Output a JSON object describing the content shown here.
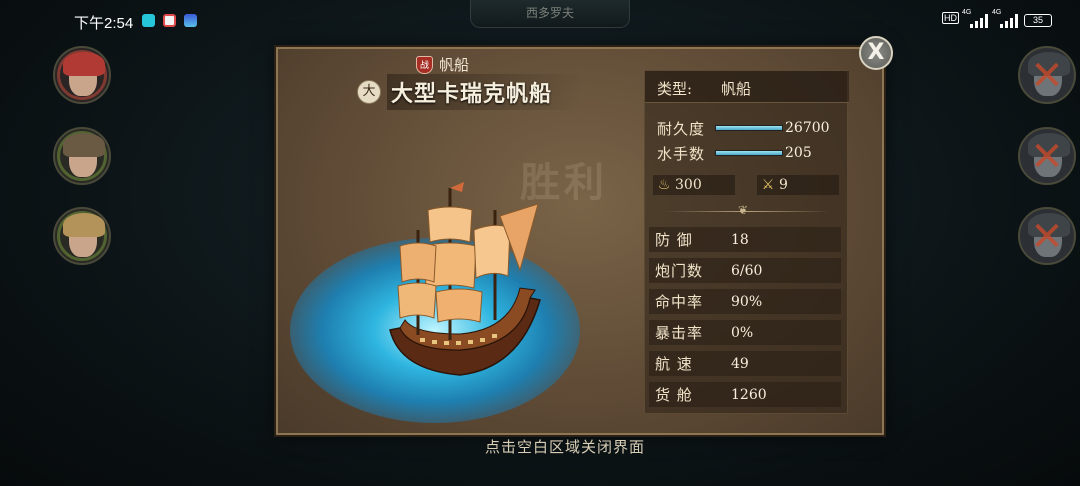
{
  "status_bar": {
    "time": "下午2:54",
    "hd": "HD",
    "signal_1": "4G",
    "signal_2": "4G",
    "battery": "35"
  },
  "top_tab": "西多罗夫",
  "close_label": "X",
  "ship": {
    "category_badge": "战",
    "category": "帆船",
    "size_badge": "大",
    "name": "大型卡瑞克帆船"
  },
  "watermark": "胜利",
  "stats": {
    "type_label": "类型:",
    "type_value": "帆船",
    "durability": {
      "label": "耐久度",
      "value": "26700",
      "fill": 1.0
    },
    "sailors": {
      "label": "水手数",
      "value": "205",
      "fill": 1.0
    },
    "supply": {
      "icon": "food-sack-icon",
      "value": "300"
    },
    "combat": {
      "icon": "crossed-swords-icon",
      "value": "9"
    },
    "attributes": [
      {
        "label": "防 御",
        "value": "18"
      },
      {
        "label": "炮门数",
        "value": "6/60"
      },
      {
        "label": "命中率",
        "value": "90%"
      },
      {
        "label": "暴击率",
        "value": "0%"
      },
      {
        "label": "航 速",
        "value": "49"
      },
      {
        "label": "货 舱",
        "value": "1260"
      }
    ]
  },
  "hint": "点击空白区域关闭界面",
  "colors": {
    "accent_bar": "#4aa8c8",
    "panel": "#5e4a35",
    "badge_red": "#a62e25"
  }
}
